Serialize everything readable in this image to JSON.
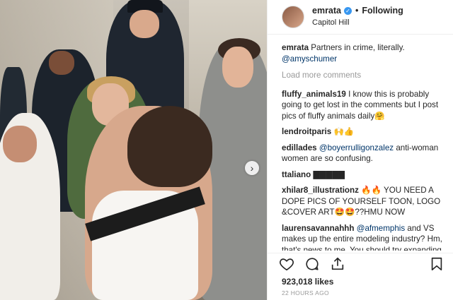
{
  "header": {
    "username": "emrata",
    "separator": "•",
    "follow_label": "Following",
    "location": "Capitol Hill"
  },
  "caption": {
    "user": "emrata",
    "text": "Partners in crime, literally.",
    "mention": "@amyschumer"
  },
  "load_more_label": "Load more comments",
  "comments": [
    {
      "user": "fluffy_animals19",
      "text": "I know this is probably going to get lost in the comments but I post pics of fluffy animals daily🤗"
    },
    {
      "user": "lendroitparis",
      "text": "🙌👍"
    },
    {
      "user": "edillades",
      "mention": "@boyerrulligonzalez",
      "text": "anti-woman women are so confusing."
    },
    {
      "user": "ttaliano",
      "text": "▇▇▇▇▇"
    },
    {
      "user": "xhilar8_illustrationz",
      "text": "🔥🔥 YOU NEED A DOPE PICS OF YOURSELF TOON, LOGO &COVER ART🤩🤩??HMU NOW"
    },
    {
      "user": "laurensavannahhh",
      "mention": "@afmemphis",
      "text": "and VS makes up the entire modeling industry? Hm, that's news to me. You should try expanding your knowledge a little more on the topic if"
    }
  ],
  "likes": "923,018 likes",
  "timestamp": "22 HOURS AGO",
  "icons": [
    "heart-icon",
    "comment-icon",
    "share-icon",
    "bookmark-icon",
    "verified-badge-icon",
    "chevron-right-icon"
  ],
  "colors": {
    "verified": "#3897f0",
    "link": "#003569",
    "muted": "#999999",
    "text": "#262626"
  }
}
